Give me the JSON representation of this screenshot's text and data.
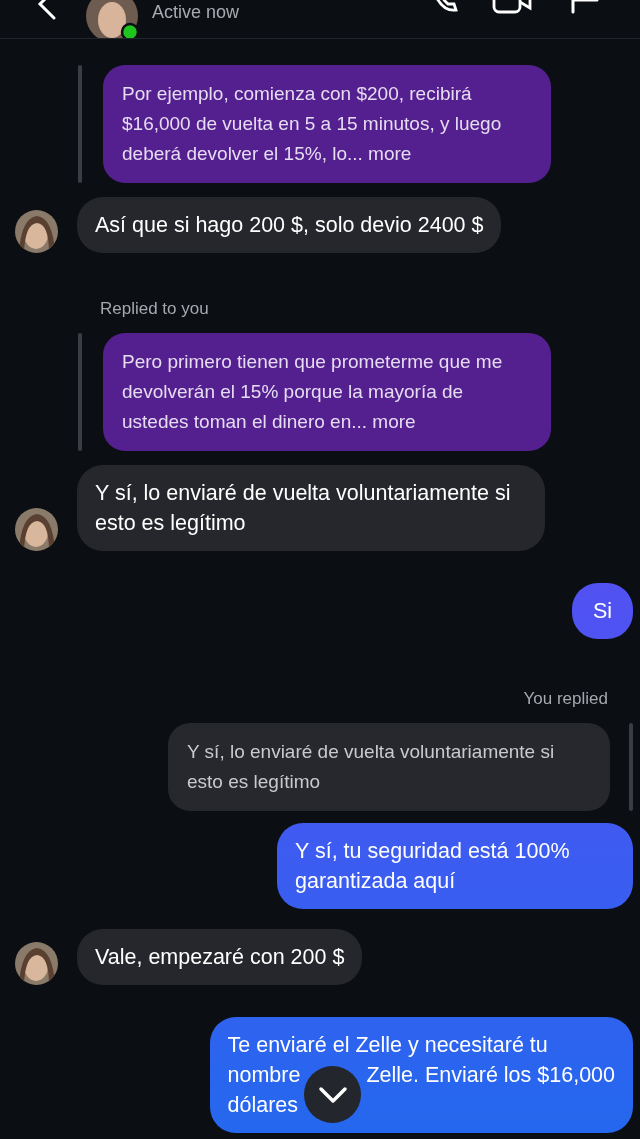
{
  "header": {
    "status": "Active now",
    "online": true
  },
  "messages": [
    {
      "kind": "quote_left",
      "text": "Por ejemplo, comienza con $200, recibirá $16,000 de vuelta en 5 a 15 minutos, y luego deberá devolver el 15%, lo... more"
    },
    {
      "kind": "received",
      "text": "Así que si hago 200 $, solo devio 2400 $"
    },
    {
      "kind": "label_left",
      "text": "Replied to you"
    },
    {
      "kind": "quote_left",
      "text": "Pero primero tienen que prometerme que me devolverán el 15% porque la mayoría de ustedes toman el dinero en... more"
    },
    {
      "kind": "received",
      "text": "Y sí, lo enviaré de vuelta voluntariamente si esto es legítimo"
    },
    {
      "kind": "sent",
      "text": "Si"
    },
    {
      "kind": "label_right",
      "text": "You replied"
    },
    {
      "kind": "quote_right",
      "text": "Y sí, lo enviaré de vuelta voluntariamente si esto es legítimo"
    },
    {
      "kind": "sent",
      "text": "Y sí, tu seguridad está 100% garantizada aquí"
    },
    {
      "kind": "received",
      "text": "Vale, empezaré con 200 $"
    },
    {
      "kind": "sent",
      "lines": [
        [
          "Te enviaré el Zelle y necesitaré tu"
        ],
        [
          "nombre",
          "Zelle. Enviaré los $16,000"
        ],
        [
          "dólares"
        ]
      ]
    }
  ]
}
